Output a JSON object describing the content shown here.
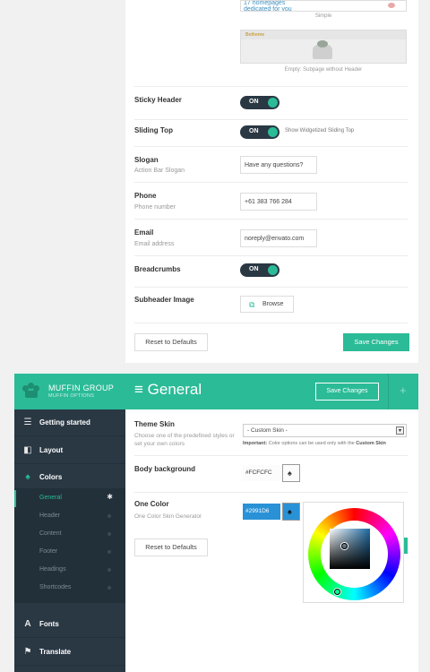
{
  "top": {
    "layouts": [
      {
        "preview_text": "17 homepages dedicated for you",
        "caption": "Simple"
      },
      {
        "preview_logo": "Betheme",
        "caption": "Empty: Subpage without Header"
      }
    ],
    "sticky_header": {
      "label": "Sticky Header",
      "toggle": "ON"
    },
    "sliding_top": {
      "label": "Sliding Top",
      "toggle": "ON",
      "note": "Show Widgetized Sliding Top"
    },
    "slogan": {
      "label": "Slogan",
      "desc": "Action Bar Slogan",
      "value": "Have any questions?"
    },
    "phone": {
      "label": "Phone",
      "desc": "Phone number",
      "value": "+61 383 766 284"
    },
    "email": {
      "label": "Email",
      "desc": "Email address",
      "value": "noreply@envato.com"
    },
    "breadcrumbs": {
      "label": "Breadcrumbs",
      "toggle": "ON"
    },
    "subheader_image": {
      "label": "Subheader Image",
      "button": "Browse"
    },
    "reset_label": "Reset to Defaults",
    "save_label": "Save Changes"
  },
  "app": {
    "brand": {
      "name": "MUFFIN GROUP",
      "sub": "MUFFIN OPTIONS"
    },
    "menu": {
      "getting_started": "Getting started",
      "layout": "Layout",
      "colors": "Colors",
      "fonts": "Fonts",
      "translate": "Translate"
    },
    "submenu": [
      "General",
      "Header",
      "Content",
      "Footer",
      "Headings",
      "Shortcodes"
    ],
    "active_submenu": "General",
    "header": {
      "title": "General",
      "save": "Save Changes",
      "plus": "+"
    },
    "theme_skin": {
      "label": "Theme Skin",
      "desc": "Choose one of the predefined styles or set your own colors",
      "selected": "- Custom Skin -",
      "important_prefix": "Important:",
      "important_text": "Color options can be used only with the",
      "important_suffix": "Custom Skin"
    },
    "body_background": {
      "label": "Body background",
      "hex": "#FCFCFC"
    },
    "one_color": {
      "label": "One Color",
      "desc": "One Color Skin Generator",
      "hex": "#2991D6"
    },
    "reset": "Reset to Defaults"
  },
  "colors": {
    "accent": "#2bbb97",
    "sidebar": "#2a3844",
    "one_color": "#2991D6",
    "body_bg": "#FCFCFC"
  }
}
